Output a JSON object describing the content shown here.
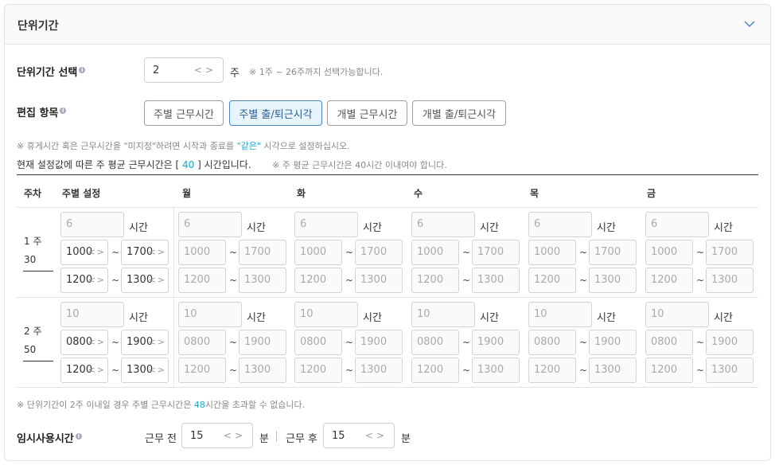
{
  "header": {
    "title": "단위기간"
  },
  "period": {
    "label": "단위기간 선택",
    "info": "i",
    "value": "2",
    "unit": "주",
    "note": "※ 1주 ~ 26주까지 선택가능합니다."
  },
  "edit": {
    "label": "편집 항목",
    "info": "i",
    "buttons": [
      "주별 근무시간",
      "주별 출/퇴근시각",
      "개별 근무시간",
      "개별 출/퇴근시각"
    ],
    "active_index": 1
  },
  "notes": {
    "break_prefix": "※  휴게시간 혹은 근무시간을 \"미지정\"하려면 시작과 종료를 ",
    "break_highlight": "\"같은\"",
    "break_suffix": " 시각으로 설정하십시오.",
    "avg_prefix": "현재 설정값에 따른 주 평균 근무시간은 [ ",
    "avg_value": "40",
    "avg_suffix": " ] 시간입니다.",
    "avg_note": "※ 주 평균 근무시간은 40시간 이내여야 합니다.",
    "limit_prefix": "※ 단위기간이 2주 이내일 경우 주별 근무시간은 ",
    "limit_value": "48",
    "limit_suffix": "시간을 초과할 수 없습니다."
  },
  "table": {
    "headers": [
      "주차",
      "주별 설정",
      "월",
      "화",
      "수",
      "목",
      "금"
    ],
    "hours_unit": "시간",
    "tilde": "~",
    "weeks": [
      {
        "label": "1 주",
        "total": "30",
        "weekly": {
          "hours": "6",
          "work_start": "1000",
          "work_end": "1700",
          "break_start": "1200",
          "break_end": "1300"
        },
        "days": {
          "hours": "6",
          "work_start": "1000",
          "work_end": "1700",
          "break_start": "1200",
          "break_end": "1300"
        }
      },
      {
        "label": "2 주",
        "total": "50",
        "weekly": {
          "hours": "10",
          "work_start": "0800",
          "work_end": "1900",
          "break_start": "1200",
          "break_end": "1300"
        },
        "days": {
          "hours": "10",
          "work_start": "0800",
          "work_end": "1900",
          "break_start": "1200",
          "break_end": "1300"
        }
      }
    ]
  },
  "temp": {
    "label": "임시사용시간",
    "info": "i",
    "before_label": "근무 전",
    "before_value": "15",
    "after_label": "근무 후",
    "after_value": "15",
    "unit": "분"
  },
  "colors": {
    "accent": "#1fa9c4",
    "active_bg": "#e8f4fb",
    "active_border": "#4a86c5"
  }
}
